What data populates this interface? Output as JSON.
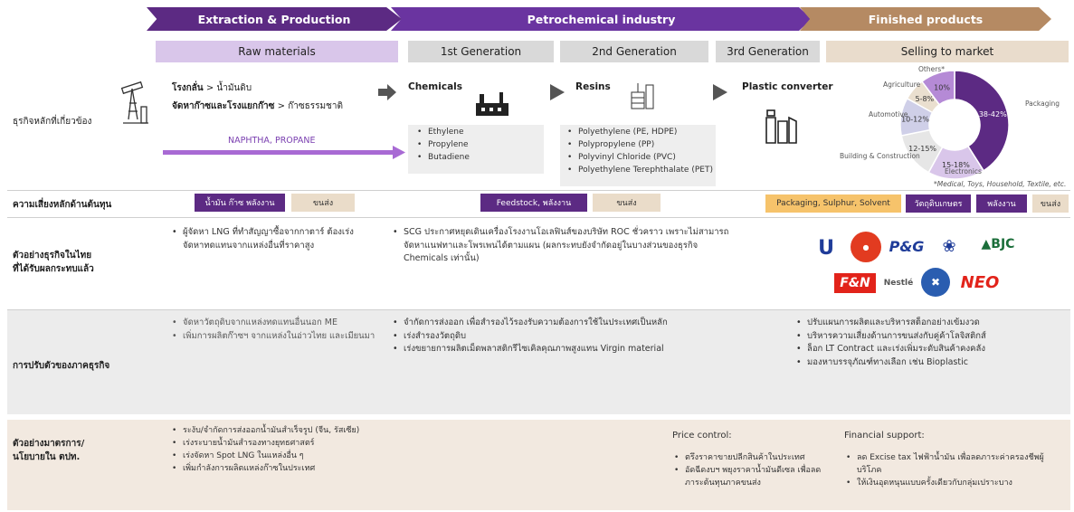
{
  "stages": {
    "extraction": "Extraction & Production",
    "petrochemical": "Petrochemical industry",
    "finished": "Finished products"
  },
  "substages": {
    "raw": "Raw materials",
    "g1": "1st Generation",
    "g2": "2nd Generation",
    "g3": "3rd Generation",
    "sell": "Selling to market"
  },
  "rows": {
    "core_business": "ธุรกิจหลักที่เกี่ยวข้อง",
    "cost_risk": "ความเสี่ยงหลักด้านต้นทุน",
    "thai_examples_1": "ตัวอย่างธุรกิจในไทย",
    "thai_examples_2": "ที่ได้รับผลกระทบแล้ว",
    "adaptation": "การปรับตัวของภาคธุรกิจ",
    "measures_1": "ตัวอย่างมาตรการ/",
    "measures_2": "นโยบายใน ตปท."
  },
  "raw": {
    "refinery_bold": "โรงกลั่น",
    "refinery_rest": " > น้ำมันดิบ",
    "gas_bold": "จัดหาก๊าซและโรงแยกก๊าซ",
    "gas_rest": " > ก๊าซธรรมชาติ",
    "arrow_label": "NAPHTHA, PROPANE"
  },
  "chemicals": {
    "title": "Chemicals",
    "items": [
      "Ethylene",
      "Propylene",
      "Butadiene"
    ]
  },
  "resins": {
    "title": "Resins",
    "items": [
      "Polyethylene (PE, HDPE)",
      "Polypropylene (PP)",
      "Polyvinyl Chloride (PVC)",
      "Polyethylene Terephthalate (PET)"
    ]
  },
  "converter": {
    "title": "Plastic converter"
  },
  "chart_data": {
    "type": "pie",
    "note": "*Medical, Toys, Household, Textile, etc.",
    "slices": [
      {
        "label": "Packaging",
        "value": "38-42%",
        "color": "#5c2a83"
      },
      {
        "label": "Electronics",
        "value": "15-18%",
        "color": "#d9c6ea"
      },
      {
        "label": "Building & Construction",
        "value": "12-15%",
        "color": "#e6e6e6"
      },
      {
        "label": "Automotive",
        "value": "10-12%",
        "color": "#cfcfe8"
      },
      {
        "label": "Agriculture",
        "value": "5-8%",
        "color": "#eadfcf"
      },
      {
        "label": "Others*",
        "value": "10%",
        "color": "#b58ad6"
      }
    ]
  },
  "risk": {
    "raw_chip1": "น้ำมัน ก๊าซ พลังงาน",
    "raw_chip2": "ขนส่ง",
    "petro_chip1": "Feedstock, พลังงาน",
    "petro_chip2": "ขนส่ง",
    "fin_chip1": "Packaging, Sulphur, Solvent",
    "fin_chip2": "วัตถุดิบเกษตร",
    "fin_chip3": "พลังงาน",
    "fin_chip4": "ขนส่ง"
  },
  "examples": {
    "raw": [
      "ผู้จัดหา LNG ที่ทำสัญญาซื้อจากกาตาร์ ต้องเร่งจัดหาทดแทนจากแหล่งอื่นที่ราคาสูง"
    ],
    "petro": [
      "SCG ประกาศหยุดเดินเครื่องโรงงานโอเลฟินส์ของบริษัท ROC ชั่วคราว เพราะไม่สามารถจัดหาแนฟทาและโพรเพนได้ตามแผน (ผลกระทบยังจำกัดอยู่ในบางส่วนของธุรกิจ Chemicals เท่านั้น)"
    ],
    "logos": [
      "Unilever",
      "BAHAMAT",
      "P&G",
      "OSOTSPA",
      "BJC",
      "F&N",
      "Nestlé",
      "Dutch Mill",
      "NEO"
    ]
  },
  "adaptation": {
    "raw": [
      "จัดหาวัตถุดิบจากแหล่งทดแทนอื่นนอก ME",
      "เพิ่มการผลิตก๊าซฯ จากแหล่งในอ่าวไทย และเมียนมา"
    ],
    "petro": [
      "จำกัดการส่งออก เพื่อสำรองไว้รองรับความต้องการใช้ในประเทศเป็นหลัก",
      "เร่งสำรองวัตถุดิบ",
      "เร่งขยายการผลิตเม็ดพลาสติกรีไซเคิลคุณภาพสูงแทน Virgin material"
    ],
    "fin": [
      "ปรับแผนการผลิตและบริหารสต็อกอย่างเข้มงวด",
      "บริหารความเสี่ยงด้านการขนส่งกับคู่ค้าโลจิสติกส์",
      "ล็อก LT Contract และเร่งเพิ่มระดับสินค้าคงคลัง",
      "มองหาบรรจุภัณฑ์ทางเลือก เช่น Bioplastic"
    ]
  },
  "measures": {
    "list": [
      "ระงับ/จำกัดการส่งออกน้ำมันสำเร็จรูป (จีน, รัสเซีย)",
      "เร่งระบายน้ำมันสำรองทางยุทธศาสตร์",
      "เร่งจัดหา Spot LNG ในแหล่งอื่น ๆ",
      "เพิ่มกำลังการผลิตแหล่งก๊าซในประเทศ"
    ],
    "price_title": "Price control:",
    "price": [
      "ตรึงราคาขายปลีกสินค้าในประเทศ",
      "อัดฉีดงบฯ พยุงราคาน้ำมันดีเซล เพื่อลดภาระต้นทุนภาคขนส่ง"
    ],
    "fin_title": "Financial support:",
    "fin": [
      "ลด Excise tax ไฟฟ้าน้ำมัน เพื่อลดภาระค่าครองชีพผู้บริโภค",
      "ให้เงินอุดหนุนแบบครั้งเดียวกับกลุ่มเปราะบาง"
    ]
  },
  "colors": {
    "purple": "#5c2a83",
    "tan": "#b58a63",
    "yellow": "#f6c36b"
  }
}
